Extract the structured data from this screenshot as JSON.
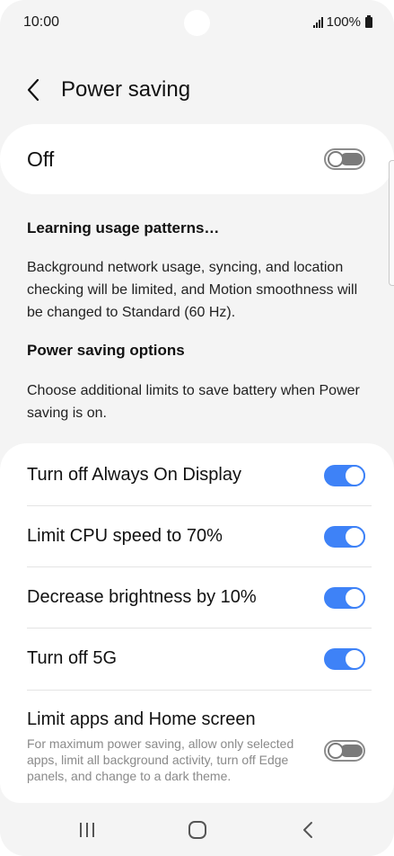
{
  "status_bar": {
    "time": "10:00",
    "battery": "100%",
    "icons": [
      "signal-icon",
      "battery-icon"
    ]
  },
  "header": {
    "title": "Power saving",
    "back_icon": "chevron-left-icon"
  },
  "master_switch": {
    "label": "Off",
    "state": "off"
  },
  "info": {
    "learning_heading": "Learning usage patterns…",
    "learning_text": "Background network usage, syncing, and location checking will be limited, and Motion smoothness will be changed to Standard (60 Hz).",
    "options_heading": "Power saving options",
    "options_text": "Choose additional limits to save battery when Power saving is on."
  },
  "options": [
    {
      "label": "Turn off Always On Display",
      "state": "on"
    },
    {
      "label": "Limit CPU speed to 70%",
      "state": "on"
    },
    {
      "label": "Decrease brightness by 10%",
      "state": "on"
    },
    {
      "label": "Turn off 5G",
      "state": "on"
    },
    {
      "label": "Limit apps and Home screen",
      "description": "For maximum power saving, allow only selected apps, limit all background activity, turn off Edge panels, and change to a dark theme.",
      "state": "off"
    }
  ],
  "nav_bar": {
    "buttons": [
      "recent-apps-icon",
      "home-icon",
      "back-icon"
    ]
  },
  "colors": {
    "accent": "#3e82f7",
    "background": "#f4f4f4",
    "card": "#ffffff",
    "toggle_off": "#7a7a7a"
  }
}
